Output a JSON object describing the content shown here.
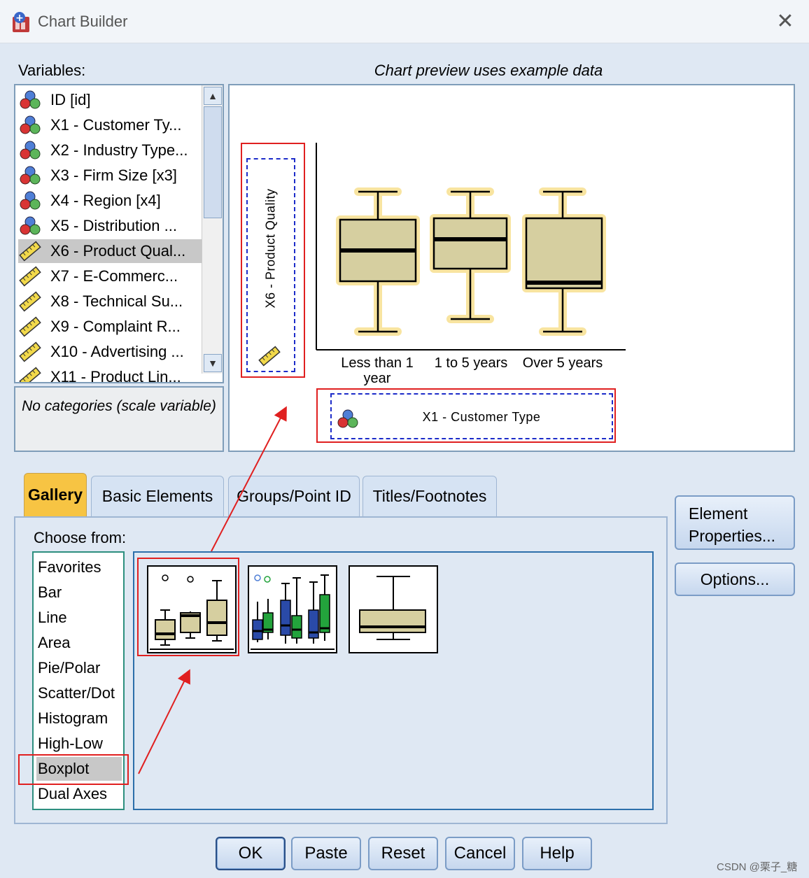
{
  "window": {
    "title": "Chart Builder",
    "close_glyph": "✕"
  },
  "variables": {
    "label": "Variables:",
    "items": [
      {
        "label": "ID [id]",
        "type": "nominal",
        "selected": false
      },
      {
        "label": "X1 - Customer Ty...",
        "type": "nominal",
        "selected": false
      },
      {
        "label": "X2 - Industry Type...",
        "type": "nominal",
        "selected": false
      },
      {
        "label": "X3 - Firm Size [x3]",
        "type": "nominal",
        "selected": false
      },
      {
        "label": "X4 - Region [x4]",
        "type": "nominal",
        "selected": false
      },
      {
        "label": "X5 - Distribution ...",
        "type": "nominal",
        "selected": false
      },
      {
        "label": "X6 - Product Qual...",
        "type": "scale",
        "selected": true
      },
      {
        "label": "X7 - E-Commerc...",
        "type": "scale",
        "selected": false
      },
      {
        "label": "X8 - Technical Su...",
        "type": "scale",
        "selected": false
      },
      {
        "label": "X9 - Complaint R...",
        "type": "scale",
        "selected": false
      },
      {
        "label": "X10 - Advertising ...",
        "type": "scale",
        "selected": false
      },
      {
        "label": "X11 - Product Lin...",
        "type": "scale",
        "selected": false
      }
    ],
    "categories_note": "No categories (scale variable)"
  },
  "preview": {
    "label": "Chart preview uses example data",
    "y_axis_variable": "X6 - Product Quality",
    "x_axis_variable": "X1 - Customer Type",
    "categories": [
      "Less than 1 year",
      "1 to 5 years",
      "Over 5 years"
    ]
  },
  "tabs": [
    {
      "label": "Gallery",
      "active": true
    },
    {
      "label": "Basic Elements",
      "active": false
    },
    {
      "label": "Groups/Point ID",
      "active": false
    },
    {
      "label": "Titles/Footnotes",
      "active": false
    }
  ],
  "gallery": {
    "choose_label": "Choose from:",
    "items": [
      "Favorites",
      "Bar",
      "Line",
      "Area",
      "Pie/Polar",
      "Scatter/Dot",
      "Histogram",
      "High-Low",
      "Boxplot",
      "Dual Axes"
    ],
    "selected": "Boxplot",
    "thumbnails": [
      "simple-boxplot",
      "clustered-boxplot",
      "1-d-boxplot"
    ]
  },
  "side_buttons": {
    "element_properties": "Element Properties...",
    "options": "Options..."
  },
  "buttons": {
    "ok": "OK",
    "paste": "Paste",
    "reset": "Reset",
    "cancel": "Cancel",
    "help": "Help"
  },
  "watermark": "CSDN @栗子_糖",
  "colors": {
    "highlight_red": "#e02020",
    "tab_active": "#f7c443",
    "box_fill": "#d6cfa0",
    "box_glow": "#f8e4a0",
    "cluster_blue": "#2a4aa8",
    "cluster_green": "#23a33c"
  }
}
